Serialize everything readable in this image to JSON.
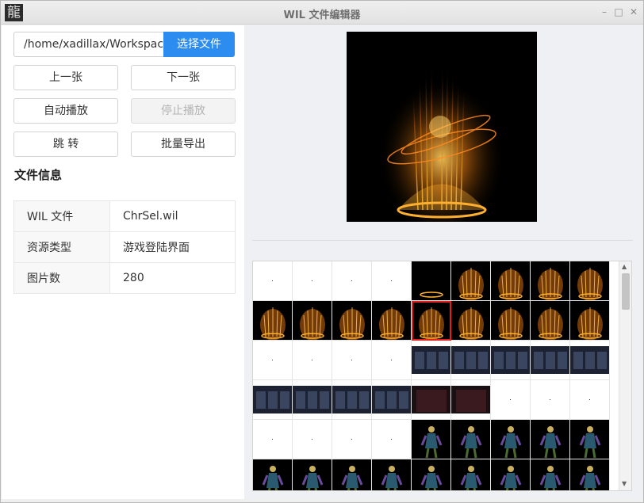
{
  "window": {
    "title": "WIL 文件编辑器",
    "app_icon_glyph": "龍",
    "controls": {
      "minimize": "–",
      "maximize": "□",
      "close": "✕"
    }
  },
  "file": {
    "path_value": "/home/xadillax/Workspace/",
    "pick_label": "选择文件"
  },
  "buttons": {
    "prev": "上一张",
    "next": "下一张",
    "autoplay": "自动播放",
    "stop": "停止播放",
    "jump": "跳 转",
    "export": "批量导出"
  },
  "info": {
    "title": "文件信息",
    "rows": [
      {
        "key": "WIL 文件",
        "value": "ChrSel.wil"
      },
      {
        "key": "资源类型",
        "value": "游戏登陆界面"
      },
      {
        "key": "图片数",
        "value": "280"
      }
    ]
  },
  "thumbnails": {
    "columns": 9,
    "selected_index": 13,
    "rows": [
      [
        "empty",
        "empty",
        "empty",
        "empty",
        "fire-small",
        "fire",
        "fire",
        "fire",
        "fire"
      ],
      [
        "fire",
        "fire",
        "fire",
        "fire",
        "fire",
        "fire",
        "fire",
        "fire",
        "fire"
      ],
      [
        "empty",
        "empty",
        "empty",
        "empty",
        "room",
        "room",
        "room",
        "room",
        "room"
      ],
      [
        "room",
        "room",
        "room",
        "room",
        "room-red",
        "room-red",
        "empty",
        "empty",
        "empty"
      ],
      [
        "empty",
        "empty",
        "empty",
        "empty",
        "char",
        "char",
        "char",
        "char",
        "char"
      ],
      [
        "char",
        "char",
        "char",
        "char",
        "char",
        "char",
        "char",
        "char",
        "char"
      ]
    ]
  },
  "colors": {
    "accent": "#2d8cf0",
    "selection": "#e02020",
    "fire": "#f0a020"
  }
}
